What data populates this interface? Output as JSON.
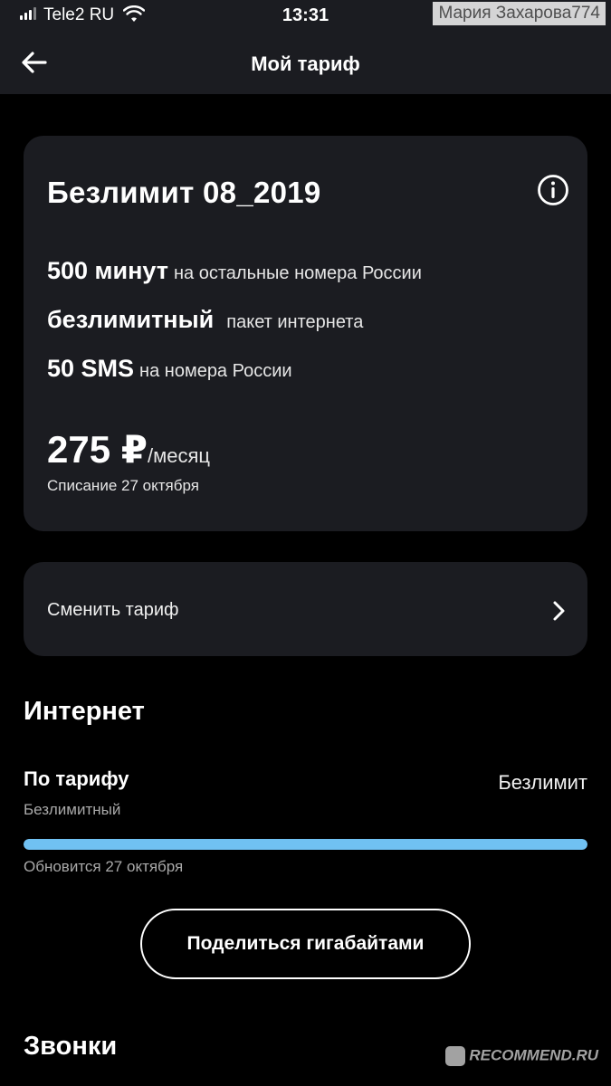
{
  "status_bar": {
    "carrier": "Tele2 RU",
    "time": "13:31",
    "watermark_user": "Мария Захарова774"
  },
  "header": {
    "title": "Мой тариф"
  },
  "tariff": {
    "name": "Безлимит 08_2019",
    "features": [
      {
        "highlight": "500 минут",
        "text": "на остальные номера России"
      },
      {
        "highlight": "безлимитный",
        "text": "пакет интернета"
      },
      {
        "highlight": "50 SMS",
        "text": "на номера России"
      }
    ],
    "price": "275 ₽",
    "price_period": "/месяц",
    "charge_date": "Списание 27 октября"
  },
  "change_tariff": {
    "label": "Сменить тариф"
  },
  "internet": {
    "section_title": "Интернет",
    "plan_label": "По тарифу",
    "plan_sub": "Безлимитный",
    "plan_value": "Безлимит",
    "progress_fraction": 1.0,
    "renew_text": "Обновится 27 октября",
    "share_button": "Поделиться гигабайтами"
  },
  "calls": {
    "section_title": "Звонки"
  },
  "watermark_site": "RECOMMEND.RU",
  "colors": {
    "background": "#000000",
    "card": "#1b1c21",
    "progress": "#70c1f2"
  }
}
